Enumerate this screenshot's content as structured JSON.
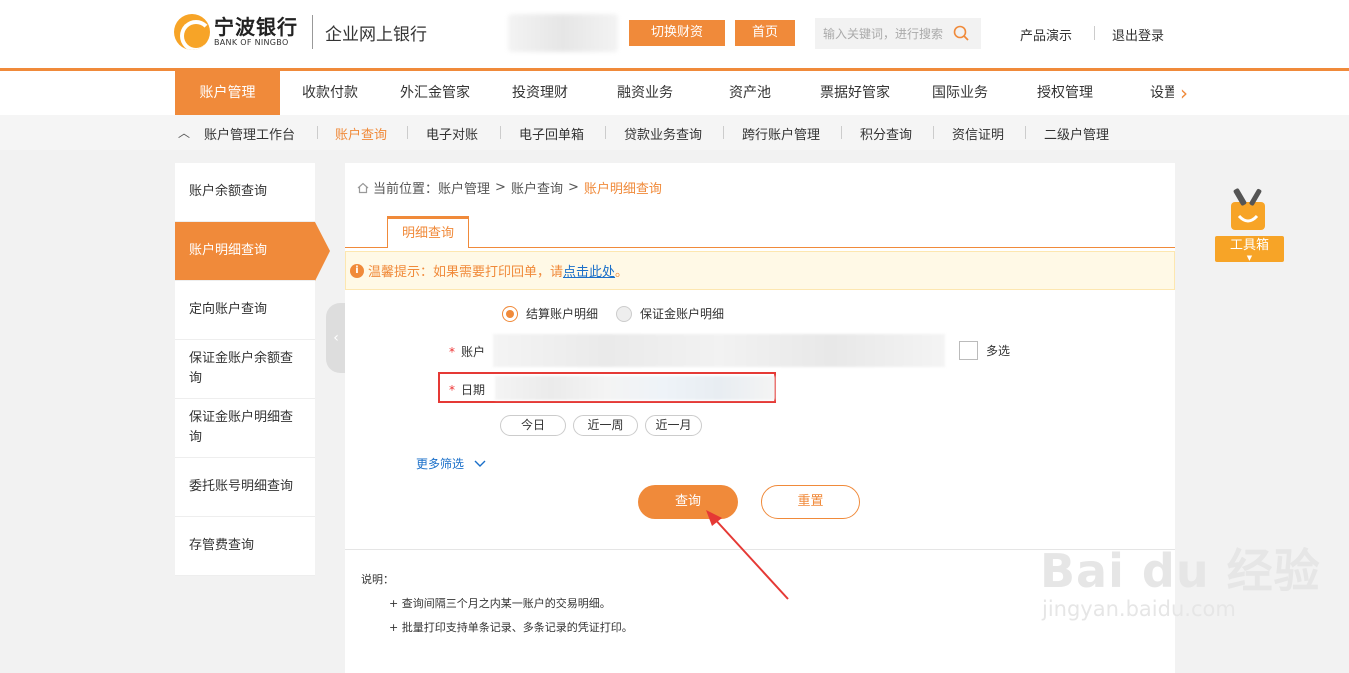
{
  "header": {
    "bank_name_cn": "宁波银行",
    "bank_name_en": "BANK OF NINGBO",
    "subtitle": "企业网上银行",
    "switch_btn": "切换财资",
    "home_btn": "首页",
    "search_placeholder": "输入关键词，进行搜索",
    "demo_link": "产品演示",
    "logout_link": "退出登录"
  },
  "mainnav": {
    "items": [
      "账户管理",
      "收款付款",
      "外汇金管家",
      "投资理财",
      "融资业务",
      "资产池",
      "票据好管家",
      "国际业务",
      "授权管理",
      "设置"
    ],
    "active_index": 0
  },
  "subnav": {
    "items": [
      "账户管理工作台",
      "账户查询",
      "电子对账",
      "电子回单箱",
      "贷款业务查询",
      "跨行账户管理",
      "积分查询",
      "资信证明",
      "二级户管理"
    ],
    "active_index": 1
  },
  "sidemenu": {
    "items": [
      "账户余额查询",
      "账户明细查询",
      "定向账户查询",
      "保证金账户余额查询",
      "保证金账户明细查询",
      "委托账号明细查询",
      "存管费查询"
    ],
    "active_index": 1
  },
  "breadcrumb": {
    "prefix": "当前位置：",
    "level1": "账户管理",
    "level2": "账户查询",
    "current": "账户明细查询",
    "sep": ">"
  },
  "tab_label": "明细查询",
  "tip": {
    "text": "温馨提示：如果需要打印回单，请",
    "link": "点击此处",
    "suffix": "。"
  },
  "form": {
    "radio_options": [
      "结算账户明细",
      "保证金账户明细"
    ],
    "radio_selected": 0,
    "account_label": "账户",
    "multi_select_label": "多选",
    "date_label": "日期",
    "quick_dates": [
      "今日",
      "近一周",
      "近一月"
    ],
    "more_filter": "更多筛选",
    "query_btn": "查询",
    "reset_btn": "重置"
  },
  "notes": {
    "title": "说明：",
    "items": [
      "+ 查询间隔三个月之内某一账户的交易明细。",
      "+ 批量打印支持单条记录、多条记录的凭证打印。"
    ]
  },
  "toolbox_label": "工具箱",
  "watermark": {
    "line1": "Bai du 经验",
    "line2": "jingyan.baidu.com"
  },
  "colors": {
    "accent": "#f08a3a",
    "link": "#1a6fc9",
    "highlight_border": "#e53935"
  }
}
